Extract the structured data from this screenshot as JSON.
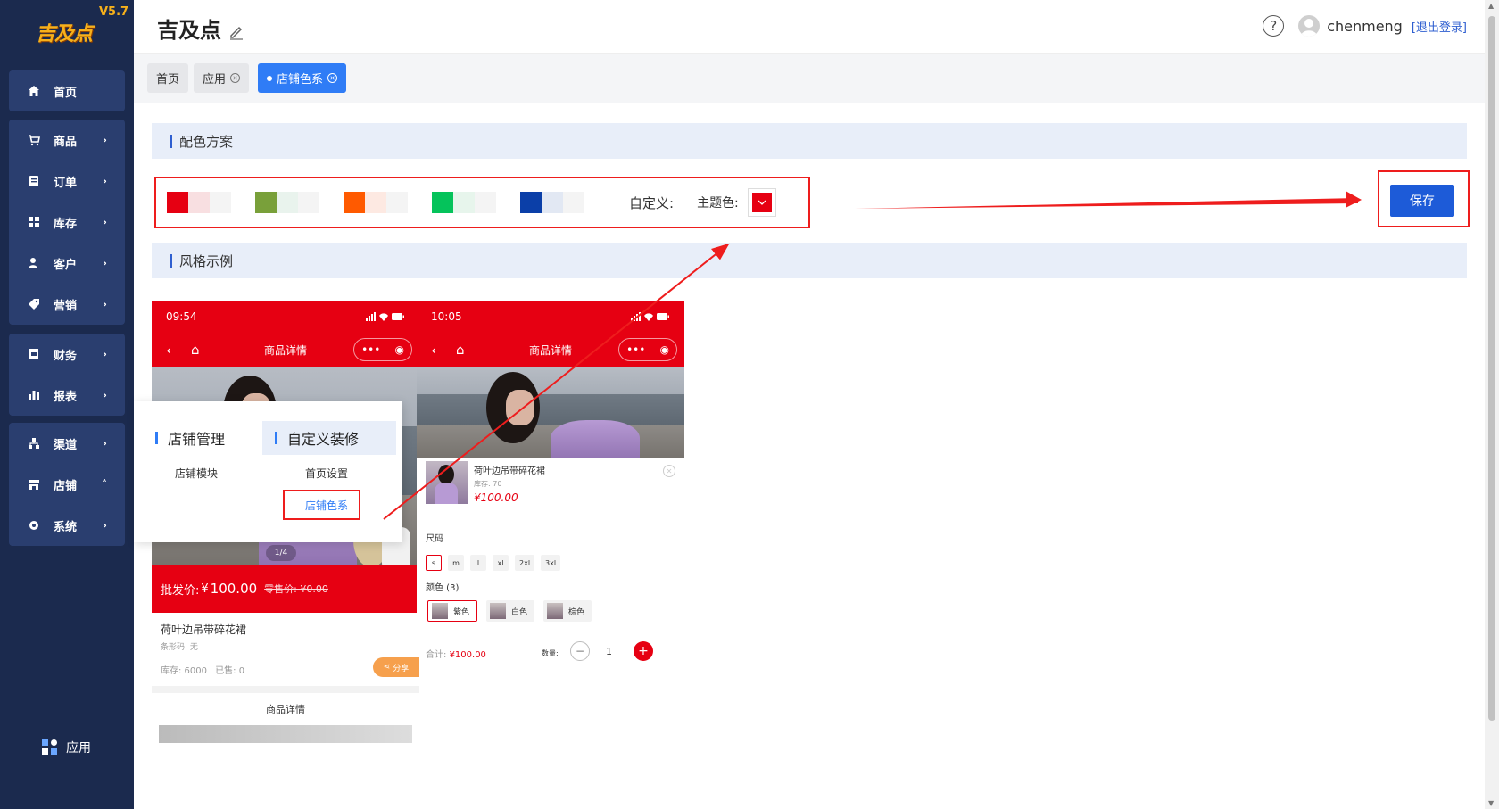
{
  "app": {
    "logo_text": "吉及点",
    "version": "V5.7"
  },
  "sidebar": {
    "items": [
      {
        "label": "首页"
      },
      {
        "label": "商品"
      },
      {
        "label": "订单"
      },
      {
        "label": "库存"
      },
      {
        "label": "客户"
      },
      {
        "label": "营销"
      },
      {
        "label": "财务"
      },
      {
        "label": "报表"
      },
      {
        "label": "渠道"
      },
      {
        "label": "店铺"
      },
      {
        "label": "系统"
      }
    ],
    "bottom_label": "应用"
  },
  "header": {
    "title": "吉及点",
    "username": "chenmeng",
    "logout": "[退出登录]",
    "help": "?"
  },
  "tabs": [
    {
      "label": "首页"
    },
    {
      "label": "应用"
    },
    {
      "label": "店铺色系"
    }
  ],
  "color_scheme": {
    "section_title": "配色方案",
    "swatches": [
      [
        "#e60012",
        "#f8dfe1",
        "#f4f4f4"
      ],
      [
        "#79a03a",
        "#e9f3ed",
        "#f4f4f4"
      ],
      [
        "#ff5a00",
        "#fde9e2",
        "#f4f4f4"
      ],
      [
        "#05c35b",
        "#e7f5ec",
        "#f4f4f4"
      ],
      [
        "#0b3fa8",
        "#e2e8f3",
        "#f4f4f4"
      ]
    ],
    "custom_label": "自定义:",
    "theme_label": "主题色:",
    "theme_color": "#e60012",
    "save_label": "保存"
  },
  "style_example": {
    "section_title": "风格示例"
  },
  "preview1": {
    "time": "09:54",
    "nav_title": "商品详情",
    "image_counter": "1/4",
    "price_label": "批发价:",
    "price_symbol": "¥",
    "price_value": "100.00",
    "retail_label": "零售价: ¥0.00",
    "product_name": "荷叶边吊带碎花裙",
    "barcode": "条形码: 无",
    "stock": "库存: 6000",
    "sold": "已售: 0",
    "share": "分享",
    "detail_title": "商品详情"
  },
  "dropdown": {
    "col1_title": "店铺管理",
    "col1_items": [
      "店铺模块"
    ],
    "col2_title": "自定义装修",
    "col2_items": [
      "首页设置",
      "店铺色系"
    ]
  },
  "preview2": {
    "time": "10:05",
    "nav_title": "商品详情",
    "sku_name": "荷叶边吊带碎花裙",
    "sku_stock": "库存: 70",
    "sku_price": "¥100.00",
    "size_label": "尺码",
    "sizes": [
      "s",
      "m",
      "l",
      "xl",
      "2xl",
      "3xl"
    ],
    "color_label": "颜色 (3)",
    "colors": [
      "紫色",
      "白色",
      "棕色"
    ],
    "total_label": "合计:",
    "total_value": "¥100.00",
    "qty_label": "数量:",
    "qty": "1",
    "minus": "−",
    "plus": "+"
  }
}
